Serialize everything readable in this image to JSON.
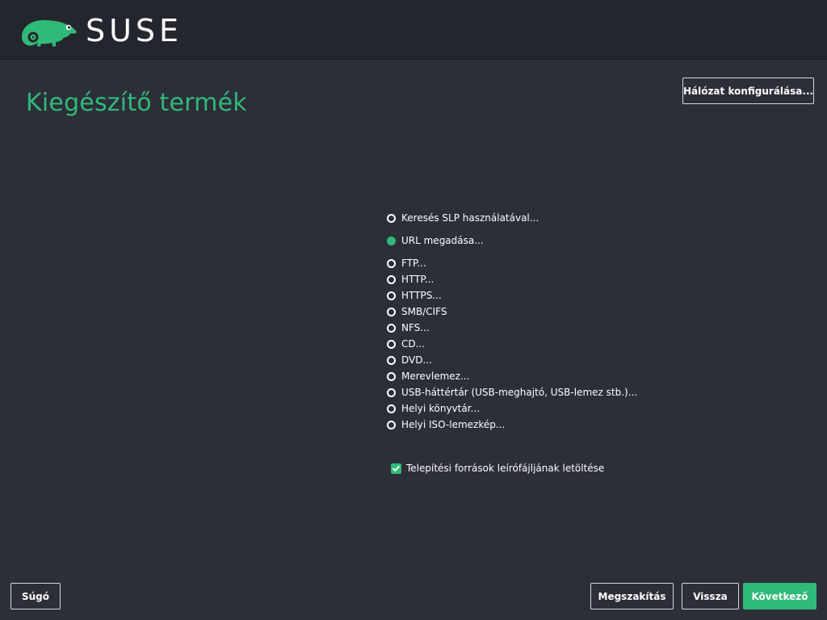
{
  "header": {
    "logo_text": "SUSE",
    "logo_icon": "chameleon-icon"
  },
  "page": {
    "title": "Kiegészítő termék"
  },
  "network_button": {
    "label": "Hálózat konfigurálása..."
  },
  "options": [
    {
      "label": "Keresés SLP használatával...",
      "selected": false
    },
    {
      "label": "URL megadása...",
      "selected": true
    },
    {
      "label": "FTP...",
      "selected": false
    },
    {
      "label": "HTTP...",
      "selected": false
    },
    {
      "label": "HTTPS...",
      "selected": false
    },
    {
      "label": "SMB/CIFS",
      "selected": false
    },
    {
      "label": "NFS...",
      "selected": false
    },
    {
      "label": "CD...",
      "selected": false
    },
    {
      "label": "DVD...",
      "selected": false
    },
    {
      "label": "Merevlemez...",
      "selected": false
    },
    {
      "label": "USB-háttértár (USB-meghajtó, USB-lemez stb.)...",
      "selected": false
    },
    {
      "label": "Helyi könyvtár...",
      "selected": false
    },
    {
      "label": "Helyi ISO-lemezkép...",
      "selected": false
    }
  ],
  "download_descriptions": {
    "label": "Telepítési források leírófájljának letöltése",
    "checked": true
  },
  "footer": {
    "help": "Súgó",
    "abort": "Megszakítás",
    "back": "Vissza",
    "next": "Következő"
  },
  "colors": {
    "accent": "#30ba78",
    "background": "#2c2e38",
    "header": "#24262e"
  }
}
